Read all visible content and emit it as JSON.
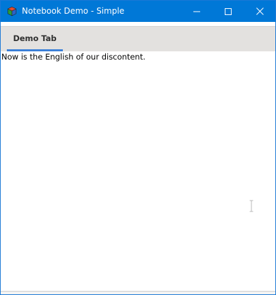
{
  "window": {
    "title": "Notebook Demo - Simple",
    "titlebar_color": "#0078d7",
    "icon": "app-cube-icon"
  },
  "controls": {
    "minimize_icon": "minimize-icon",
    "maximize_icon": "maximize-icon",
    "close_icon": "close-icon"
  },
  "tabs": [
    {
      "label": "Demo Tab",
      "selected": true,
      "accent": "#3b80d8"
    }
  ],
  "content": {
    "text": "Now is the English of our discontent."
  },
  "cursor_icon": "text-cursor-icon"
}
